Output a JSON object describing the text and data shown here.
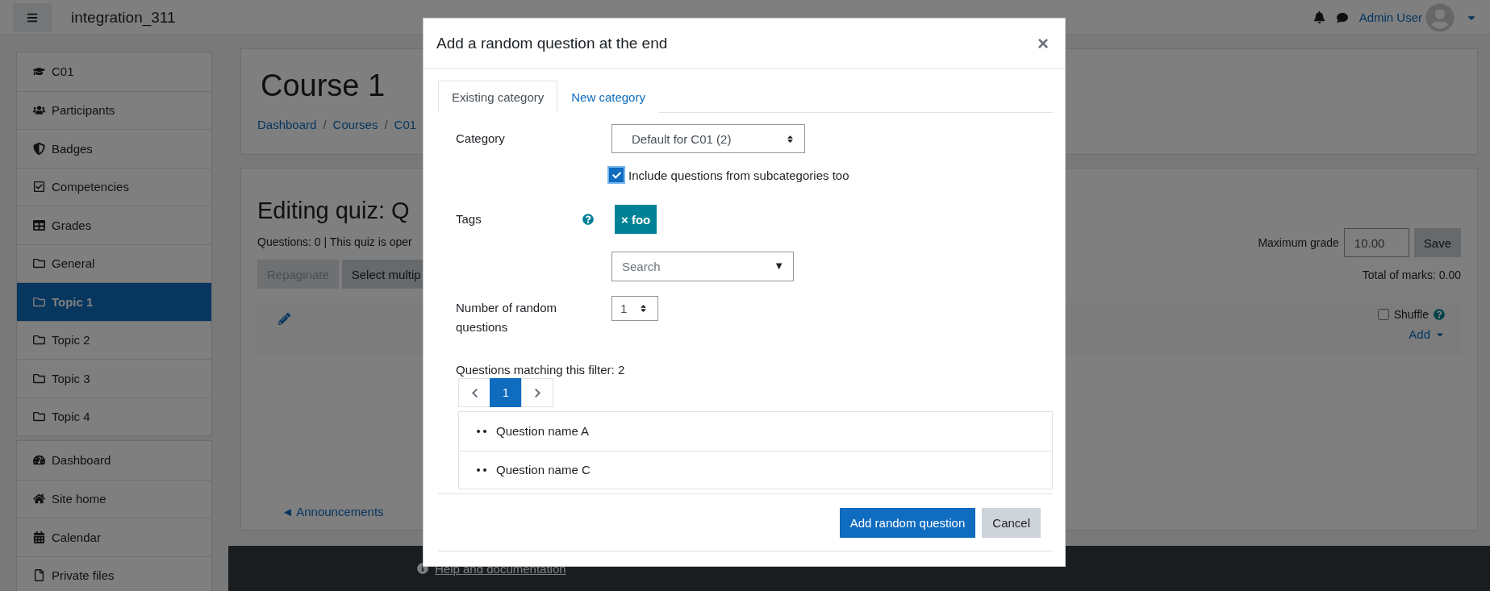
{
  "navbar": {
    "site_name": "integration_311",
    "user_name": "Admin User"
  },
  "sidebar": {
    "groups": [
      [
        {
          "label": "C01",
          "selected": false
        },
        {
          "label": "Participants",
          "selected": false
        },
        {
          "label": "Badges",
          "selected": false
        },
        {
          "label": "Competencies",
          "selected": false
        },
        {
          "label": "Grades",
          "selected": false
        },
        {
          "label": "General",
          "selected": false
        },
        {
          "label": "Topic 1",
          "selected": true
        },
        {
          "label": "Topic 2",
          "selected": false
        },
        {
          "label": "Topic 3",
          "selected": false
        },
        {
          "label": "Topic 4",
          "selected": false
        }
      ],
      [
        {
          "label": "Dashboard",
          "selected": false
        },
        {
          "label": "Site home",
          "selected": false
        },
        {
          "label": "Calendar",
          "selected": false
        },
        {
          "label": "Private files",
          "selected": false
        }
      ]
    ]
  },
  "course": {
    "title": "Course 1",
    "breadcrumb": [
      "Dashboard",
      "Courses",
      "C01"
    ],
    "separator": "/"
  },
  "quiz": {
    "title": "Editing quiz: Q",
    "info": "Questions: 0 | This quiz is oper",
    "buttons": [
      {
        "label": "Repaginate",
        "disabled": true
      },
      {
        "label": "Select multip",
        "disabled": false
      }
    ],
    "max_grade_label": "Maximum grade",
    "max_grade_value": "10.00",
    "save": "Save",
    "total": "Total of marks: 0.00",
    "shuffle": {
      "label": "Shuffle",
      "checked": false
    },
    "add": "Add",
    "prev_link": "◄ Announcements"
  },
  "footer": {
    "help": "Help and documentation"
  },
  "modal": {
    "title": "Add a random question at the end",
    "close": "×",
    "tabs": [
      {
        "label": "Existing category",
        "selected": true
      },
      {
        "label": "New category",
        "selected": false
      }
    ],
    "category_label": "Category",
    "category_value": "Default for C01 (2)",
    "subcategories": {
      "label": "Include questions from subcategories too",
      "checked": true
    },
    "tags_label": "Tags",
    "tags": [
      "× foo"
    ],
    "tag_search": {
      "placeholder": "Search",
      "arrow": "▼"
    },
    "number_label": "Number of random questions",
    "number_value": "1",
    "matching": "Questions matching this filter: 2",
    "pages": [
      {
        "label": "1",
        "selected": true
      }
    ],
    "questions": [
      "Question name A",
      "Question name C"
    ],
    "buttons": [
      {
        "label": "Add random question",
        "kind": "primary"
      },
      {
        "label": "Cancel",
        "kind": "secondary"
      }
    ]
  }
}
